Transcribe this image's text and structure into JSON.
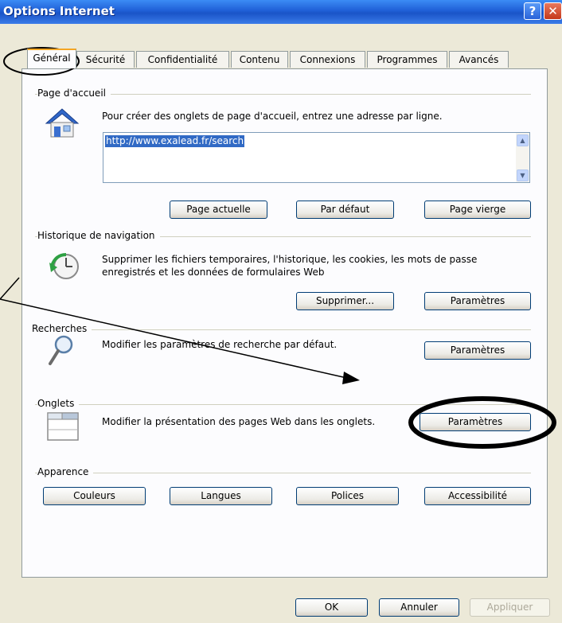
{
  "window": {
    "title": "Options Internet",
    "help_glyph": "?",
    "close_glyph": "✕"
  },
  "tabs": [
    "Général",
    "Sécurité",
    "Confidentialité",
    "Contenu",
    "Connexions",
    "Programmes",
    "Avancés"
  ],
  "home": {
    "group_label": "Page d'accueil",
    "description": "Pour créer des onglets de page d'accueil, entrez une adresse par ligne.",
    "url": "http://www.exalead.fr/search",
    "buttons": {
      "current": "Page actuelle",
      "default": "Par défaut",
      "blank": "Page vierge"
    }
  },
  "history": {
    "group_label": "Historique de navigation",
    "description_line1": "Supprimer les fichiers temporaires, l'historique, les cookies, les mots de passe",
    "description_line2": "enregistrés et les données de formulaires Web",
    "buttons": {
      "delete": "Supprimer...",
      "settings": "Paramètres"
    }
  },
  "search": {
    "group_label": "Recherches",
    "description": "Modifier les paramètres de recherche par défaut.",
    "button": "Paramètres"
  },
  "tabs_group": {
    "group_label": "Onglets",
    "description": "Modifier la présentation des pages Web dans les onglets.",
    "button": "Paramètres"
  },
  "appearance": {
    "group_label": "Apparence",
    "buttons": {
      "colors": "Couleurs",
      "languages": "Langues",
      "fonts": "Polices",
      "accessibility": "Accessibilité"
    }
  },
  "footer": {
    "ok": "OK",
    "cancel": "Annuler",
    "apply": "Appliquer"
  },
  "colors": {
    "titlebar": "#1f5fd6",
    "dialog_bg": "#ece9d8",
    "panel_bg": "#fcfcfe",
    "selection": "#316ac5",
    "annotation": "#000000"
  },
  "icons": [
    "home-icon",
    "history-icon",
    "search-magnifier-icon",
    "tabs-window-icon",
    "help-icon",
    "close-icon"
  ]
}
